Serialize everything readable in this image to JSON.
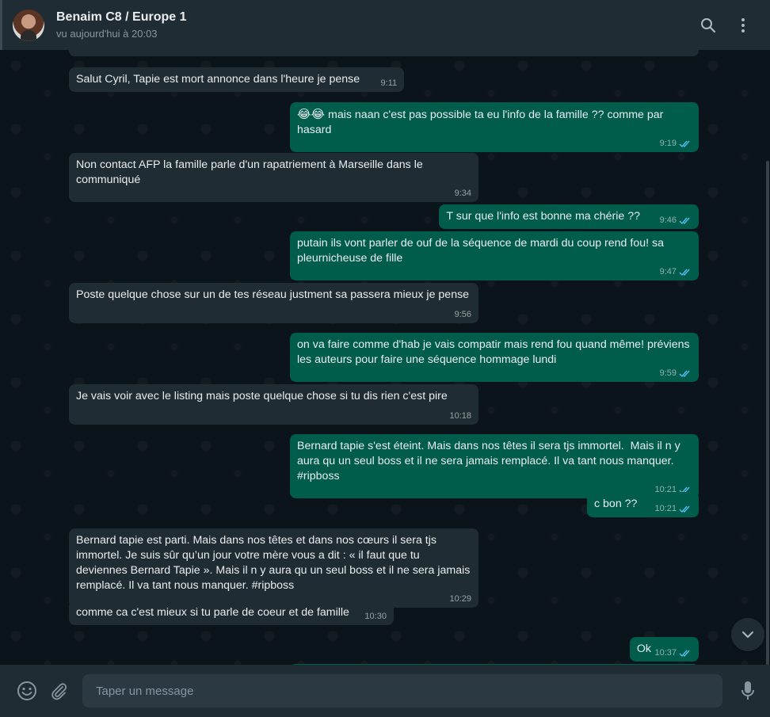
{
  "header": {
    "contact_name": "Benaim C8 / Europe 1",
    "status": "vu aujourd'hui à 20:03"
  },
  "icons": {
    "search": "search-icon",
    "menu": "more-vertical-icon",
    "emoji": "emoji-icon",
    "attach": "paperclip-icon",
    "mic": "microphone-icon",
    "scroll_down": "chevron-down-icon",
    "read": "double-check-icon"
  },
  "colors": {
    "incoming_bubble": "#202c33",
    "outgoing_bubble": "#005c4b",
    "background": "#0b141a",
    "read_tick": "#53bdeb"
  },
  "messages": [
    {
      "direction": "in",
      "text": "Salut Cyril, Tapie est mort annonce dans l'heure je pense",
      "time": "9:11"
    },
    {
      "direction": "out",
      "emoji": "😂😂",
      "text": "mais naan c'est pas possible ta eu l'info de la famille ?? comme par hasard",
      "time": "9:19",
      "read": true
    },
    {
      "direction": "in",
      "text": "Non contact AFP la famille parle d'un rapatriement à Marseille dans le communiqué",
      "time": "9:34"
    },
    {
      "direction": "out",
      "text": "T sur que l'info est bonne ma chérie ??",
      "time": "9:46",
      "read": true
    },
    {
      "direction": "out",
      "text": "putain ils vont parler de ouf de la séquence de mardi du coup rend fou! sa pleurnicheuse de fille",
      "time": "9:47",
      "read": true
    },
    {
      "direction": "in",
      "text": "Poste quelque chose sur un de tes réseau justment sa passera mieux je pense",
      "time": "9:56"
    },
    {
      "direction": "out",
      "text": "on va faire comme d'hab je vais compatir mais rend fou quand même! préviens les auteurs pour faire une séquence hommage lundi",
      "time": "9:59",
      "read": true
    },
    {
      "direction": "in",
      "text": "Je vais voir avec le listing mais poste quelque chose si tu dis rien c'est pire",
      "time": "10:18"
    },
    {
      "direction": "out",
      "text": "Bernard tapie s'est éteint. Mais dans nos têtes il sera tjs immortel.  Mais il n y aura qu un seul boss et il ne sera jamais remplacé. Il va tant nous manquer. #ripboss",
      "time": "10:21",
      "read": true
    },
    {
      "direction": "out",
      "text": "c bon ??",
      "time": "10:21",
      "read": true
    },
    {
      "direction": "in",
      "text": "Bernard tapie est parti. Mais dans nos têtes et dans nos cœurs il sera tjs immortel. Je suis sûr qu’un jour votre mère vous a dit : « il faut que tu deviennes Bernard Tapie ». Mais il n y aura qu un seul boss et il ne sera jamais remplacé. Il va tant nous manquer. #ripboss",
      "time": "10:29"
    },
    {
      "direction": "in",
      "text": "comme ca c'est mieux si tu parle de coeur et de famille",
      "time": "10:30"
    },
    {
      "direction": "out",
      "text": "Ok",
      "time": "10:37",
      "read": true
    }
  ],
  "composer": {
    "placeholder": "Taper un message"
  }
}
